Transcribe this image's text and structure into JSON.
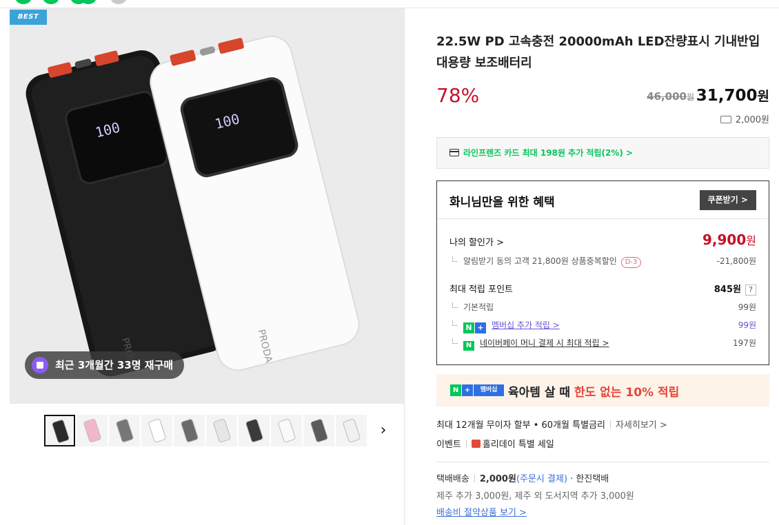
{
  "image_panel": {
    "badge": "BEST",
    "rebuy_text": "최근 3개월간 33명 재구매",
    "thumbnails": [
      {
        "name": "black-powerbank",
        "color": "#2b2b2b"
      },
      {
        "name": "color-lineup",
        "color": "#f2b7c9"
      },
      {
        "name": "gray-side",
        "color": "#777777"
      },
      {
        "name": "white-single",
        "color": "#ffffff"
      },
      {
        "name": "gray-pair",
        "color": "#6b6b6b"
      },
      {
        "name": "white-pair",
        "color": "#e6e6e6"
      },
      {
        "name": "black-front",
        "color": "#3a3a3a"
      },
      {
        "name": "white-front",
        "color": "#fafafa"
      },
      {
        "name": "gray-strap",
        "color": "#5a5a5a"
      },
      {
        "name": "white-strap",
        "color": "#f0f0f0"
      }
    ]
  },
  "product": {
    "title": "22.5W PD 고속충전 20000mAh LED잔량표시 기내반입 대용량 보조배터리",
    "discount_rate": "78%",
    "original_price": "46,000",
    "original_unit": "원",
    "sale_price": "31,700",
    "sale_unit": "원",
    "shipping_fee": "2,000원"
  },
  "card_banner": {
    "text": "라인프렌즈 카드 최대 198원 추가 적립(2%) >"
  },
  "benefit": {
    "title": "화니님만을 위한 혜택",
    "coupon_button": "쿠폰받기 >",
    "my_price_label": "나의 할인가 >",
    "my_price": "9,900",
    "my_price_unit": "원",
    "alarm_text": "알림받기 동의 고객 21,800원 상품중복할인",
    "alarm_badge": "D-3",
    "alarm_amount": "-21,800원",
    "points_label": "최대 적립 포인트",
    "points_value": "845원",
    "points_help": "?",
    "basic_label": "기본적립",
    "basic_value": "99원",
    "member_label": "멤버십 추가 적립 >",
    "member_value": "99원",
    "npay_label": "네이버페이 머니 결제 시 최대 적립 >",
    "npay_value": "197원"
  },
  "promo": {
    "badge_membership": "멤버십",
    "text_main": "육아템 살 때 ",
    "text_highlight": "한도 없는 10% 적립"
  },
  "info": {
    "installment": "최대 12개월 무이자 할부 • 60개월 특별금리",
    "installment_link": "자세히보기 >",
    "event_label": "이벤트",
    "event_text": "홀리데이 특별 세일",
    "ship_type": "택배배송",
    "ship_fee": "2,000원",
    "ship_note": "(주문시 결제)",
    "ship_carrier": "· 한진택배",
    "ship_extra": "제주 추가 3,000원, 제주 외 도서지역 추가 3,000원",
    "ship_link": "배송비 절약상품 보기 >"
  },
  "colors": {
    "accent_green": "#03c75a",
    "price_red": "#c5112b",
    "promo_red": "#e6453a",
    "link_blue": "#3b6fd6"
  }
}
